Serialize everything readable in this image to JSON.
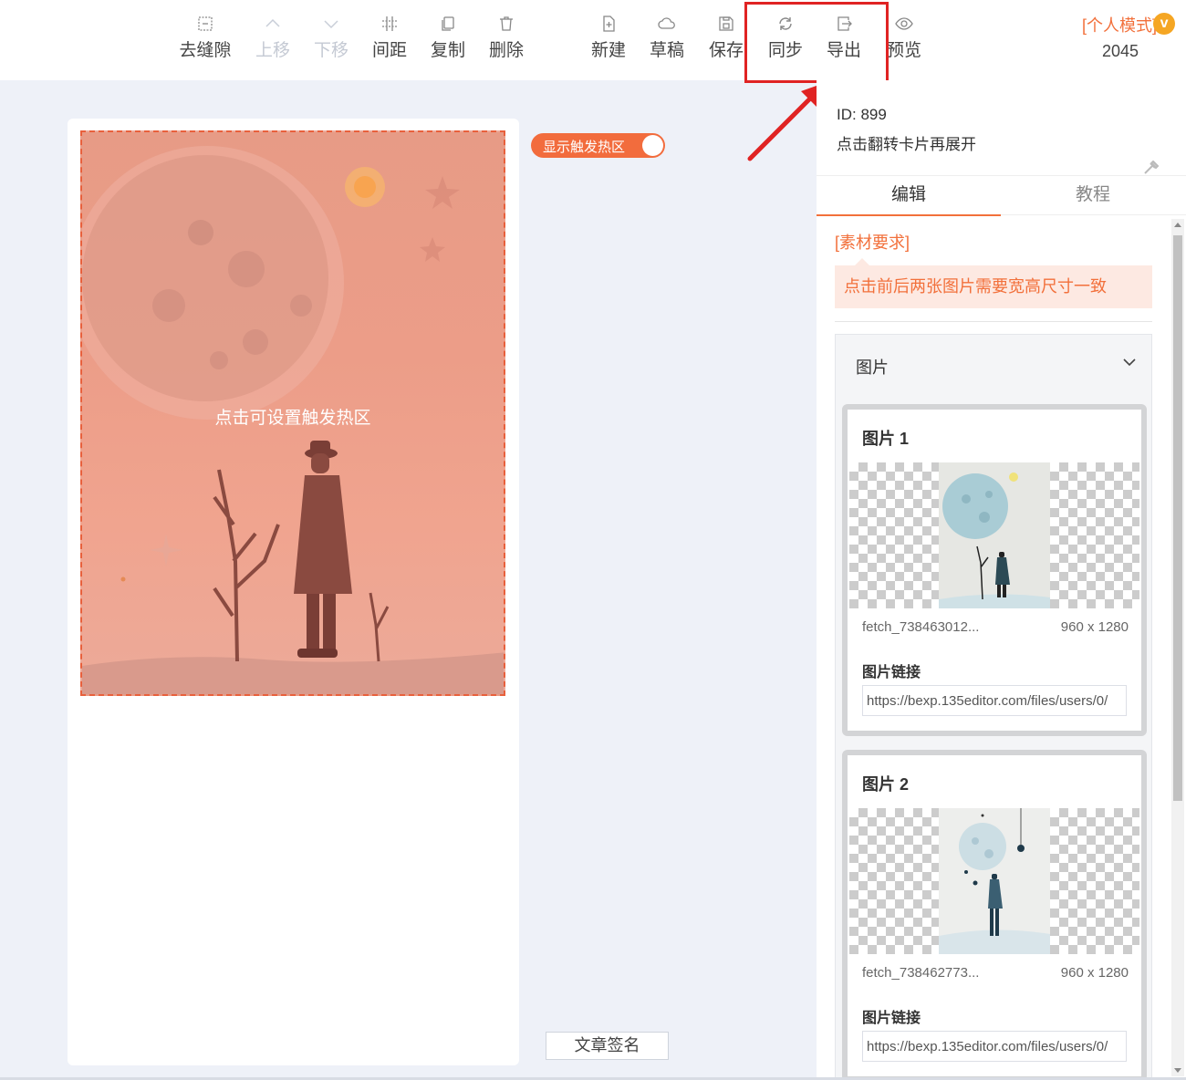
{
  "toolbar": {
    "items": [
      {
        "label": "去缝隙",
        "icon": "gap-remove-icon",
        "enabled": true
      },
      {
        "label": "上移",
        "icon": "chevron-up-icon",
        "enabled": false
      },
      {
        "label": "下移",
        "icon": "chevron-down-icon",
        "enabled": false
      },
      {
        "label": "间距",
        "icon": "spacing-icon",
        "enabled": true
      },
      {
        "label": "复制",
        "icon": "copy-icon",
        "enabled": true
      },
      {
        "label": "删除",
        "icon": "trash-icon",
        "enabled": true
      },
      {
        "label": "新建",
        "icon": "new-file-icon",
        "enabled": true
      },
      {
        "label": "草稿",
        "icon": "cloud-icon",
        "enabled": true
      },
      {
        "label": "保存",
        "icon": "save-icon",
        "enabled": true
      },
      {
        "label": "同步",
        "icon": "sync-icon",
        "enabled": true
      },
      {
        "label": "导出",
        "icon": "export-icon",
        "enabled": true
      },
      {
        "label": "预览",
        "icon": "eye-icon",
        "enabled": true
      }
    ],
    "mode_label": "[个人模式]",
    "badge": "v",
    "count": "2045"
  },
  "canvas": {
    "hotspot_hint": "点击可设置触发热区",
    "toggle_label": "显示触发热区",
    "toggle_on": true,
    "signature_button": "文章签名"
  },
  "panel": {
    "id_text": "ID: 899",
    "description": "点击翻转卡片再展开",
    "tabs": [
      "编辑",
      "教程"
    ],
    "active_tab": "编辑",
    "requirements_title": "[素材要求]",
    "requirements_text": "点击前后两张图片需要宽高尺寸一致",
    "section_title": "图片",
    "images": [
      {
        "title": "图片 1",
        "filename": "fetch_738463012...",
        "size": "960 x 1280",
        "link_label": "图片链接",
        "link": "https://bexp.135editor.com/files/users/0/"
      },
      {
        "title": "图片 2",
        "filename": "fetch_738462773...",
        "size": "960 x 1280",
        "link_label": "图片链接",
        "link": "https://bexp.135editor.com/files/users/0/"
      }
    ]
  },
  "colors": {
    "accent": "#f2703b",
    "highlight": "#e02323",
    "poster": "#ec9d88"
  }
}
